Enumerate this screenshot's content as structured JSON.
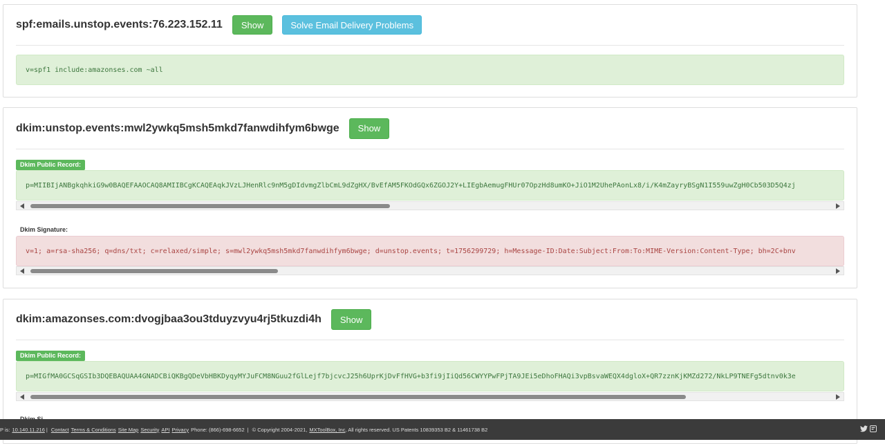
{
  "spf": {
    "title": "spf:emails.unstop.events:76.223.152.11",
    "show_label": "Show",
    "solve_label": "Solve Email Delivery Problems",
    "record": "v=spf1 include:amazonses.com ~all"
  },
  "dkim1": {
    "title": "dkim:unstop.events:mwl2ywkq5msh5mkd7fanwdihfym6bwge",
    "show_label": "Show",
    "public_record_label": "Dkim Public Record:",
    "public_record": "p=MIIBIjANBgkqhkiG9w0BAQEFAAOCAQ8AMIIBCgKCAQEAqkJVzLJHenRlc9nM5gDIdvmgZlbCmL9dZgHX/BvEfAM5FKOdGQx6ZGOJ2Y+LIEgbAemugFHUr07OpzHd8umKO+JiO1M2UhePAonLx8/i/K4mZayryBSgN1I559uwZgH0Cb503D5Q4zj",
    "public_thumb": 0.45,
    "signature_label": "Dkim Signature:",
    "signature": "v=1; a=rsa-sha256; q=dns/txt; c=relaxed/simple; s=mwl2ywkq5msh5mkd7fanwdihfym6bwge; d=unstop.events; t=1756299729; h=Message-ID:Date:Subject:From:To:MIME-Version:Content-Type; bh=2C+bnv",
    "signature_thumb": 0.31
  },
  "dkim2": {
    "title": "dkim:amazonses.com:dvogjbaa3ou3tduyzvyu4rj5tkuzdi4h",
    "show_label": "Show",
    "public_record_label": "Dkim Public Record:",
    "public_record": "p=MIGfMA0GCSqGSIb3DQEBAQUAA4GNADCBiQKBgQDeVbHBKDyqyMYJuFCM8NGuu2fGlLejf7bjcvcJ25h6UprKjDvFfHVG+b3fi9jIiQd56CWYYPwFPjTA9JEi5eDhoFHAQi3vpBsvaWEQX4dgloX+QR7zznKjKMZd272/NkLP9TNEFg5dtnv0k3e",
    "public_thumb": 0.82,
    "signature_label": "Dkim Si"
  },
  "footer": {
    "ip_prefix": "P is:",
    "ip": "10.140.11.216",
    "sep": "|",
    "links": [
      "Contact",
      "Terms & Conditions",
      "Site Map",
      "Security",
      "API",
      "Privacy"
    ],
    "phone": "Phone: (866)-698-6652",
    "copyright": "© Copyright 2004-2021,",
    "company": "MXToolBox, Inc",
    "rights": ", All rights reserved. US Patents 10839353 B2 & 11461738 B2",
    "icons": [
      "twitter-icon",
      "blog-icon"
    ]
  }
}
